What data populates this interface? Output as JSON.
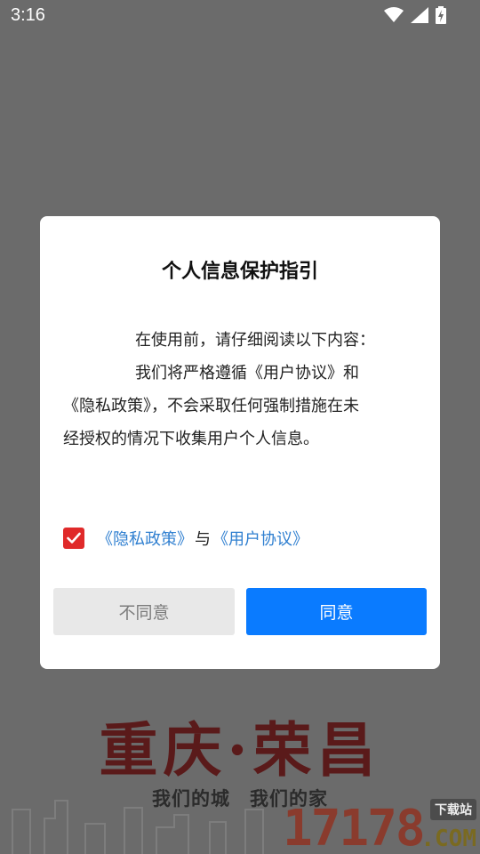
{
  "status_bar": {
    "time": "3:16",
    "icons": [
      "wifi-icon",
      "signal-icon",
      "battery-charging-icon"
    ]
  },
  "dialog": {
    "title": "个人信息保护指引",
    "body": {
      "line1": "在使用前，请仔细阅读以下内容：",
      "line2": "我们将严格遵循《用户协议》和",
      "line3": "《隐私政策》，不会采取任何强制措施在未",
      "line4": "经授权的情况下收集用户个人信息。"
    },
    "agreement": {
      "checked": true,
      "privacy_link": "《隐私政策》",
      "separator": "与",
      "user_link": "《用户协议》"
    },
    "buttons": {
      "disagree_label": "不同意",
      "agree_label": "同意"
    }
  },
  "background": {
    "splash_title": "重庆·荣昌",
    "splash_subtitle": "我们的城　我们的家",
    "watermark_number": "17178",
    "watermark_tag": "下载站",
    "watermark_domain": ".COM"
  },
  "colors": {
    "overlay": "#6b6b6b",
    "accent_blue": "#0a7bff",
    "link_blue": "#2f7fd0",
    "checkbox_red": "#e02a2a"
  }
}
